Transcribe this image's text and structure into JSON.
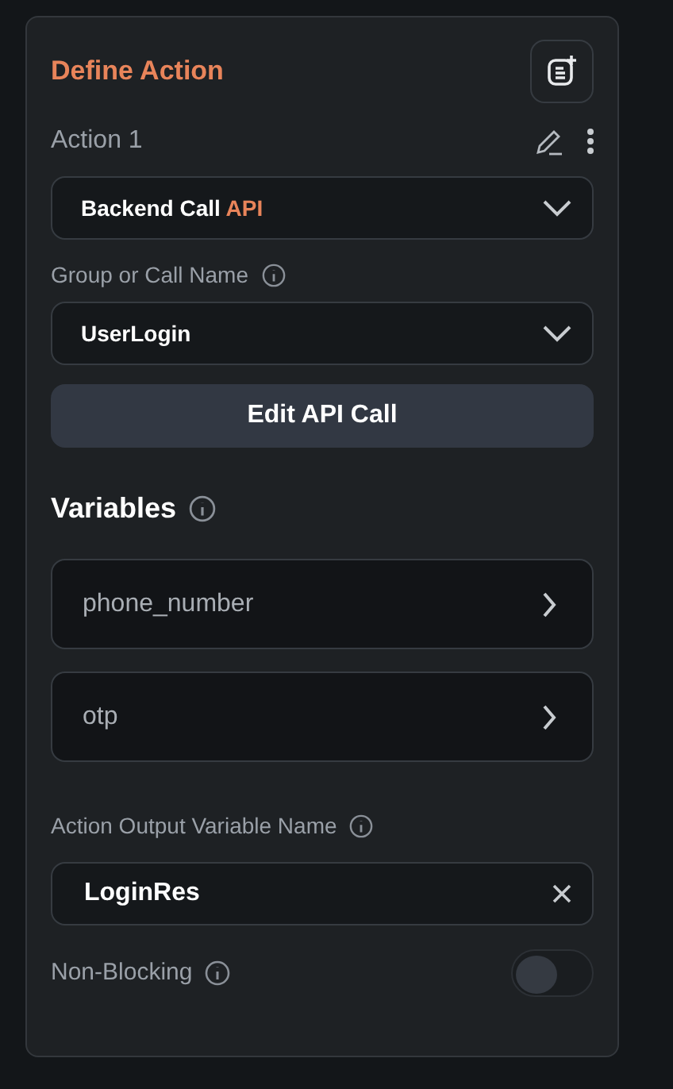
{
  "panel": {
    "title": "Define Action"
  },
  "action": {
    "name": "Action 1"
  },
  "action_type": {
    "value": "Backend Call",
    "tag": "API"
  },
  "call_name": {
    "label": "Group or Call Name",
    "value": "UserLogin"
  },
  "edit_button": "Edit API Call",
  "variables": {
    "heading": "Variables",
    "items": [
      {
        "name": "phone_number"
      },
      {
        "name": "otp"
      }
    ]
  },
  "output": {
    "label": "Action Output Variable Name",
    "value": "LoginRes"
  },
  "non_blocking": {
    "label": "Non-Blocking",
    "on": false
  }
}
